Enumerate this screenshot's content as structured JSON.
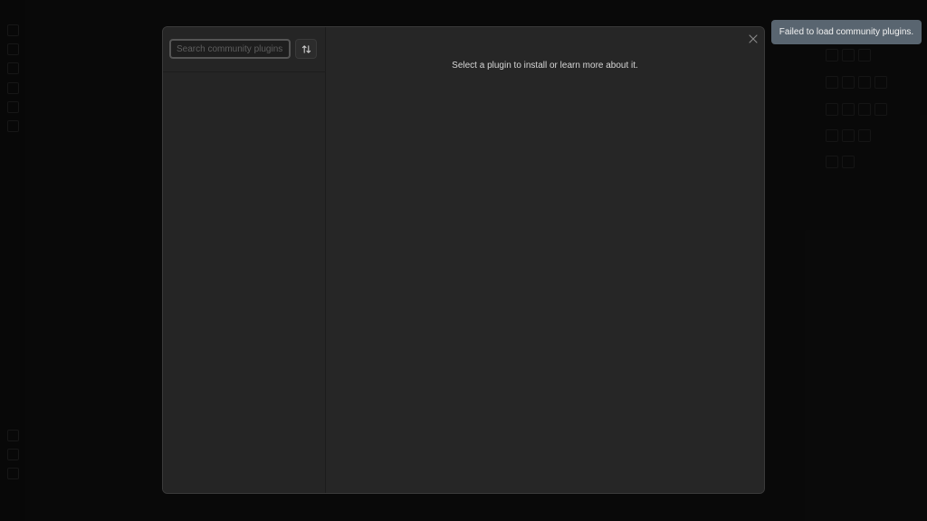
{
  "search": {
    "placeholder": "Search community plugins..."
  },
  "sort_button": {
    "icon": "sort-arrows-icon"
  },
  "content": {
    "empty_message": "Select a plugin to install or learn more about it."
  },
  "close_button": {
    "icon": "close-icon"
  },
  "notice": {
    "text": "Failed to load community plugins."
  },
  "colors": {
    "modal_bg": "#262626",
    "notice_bg": "#596570",
    "app_bg": "#0d0d0d"
  }
}
